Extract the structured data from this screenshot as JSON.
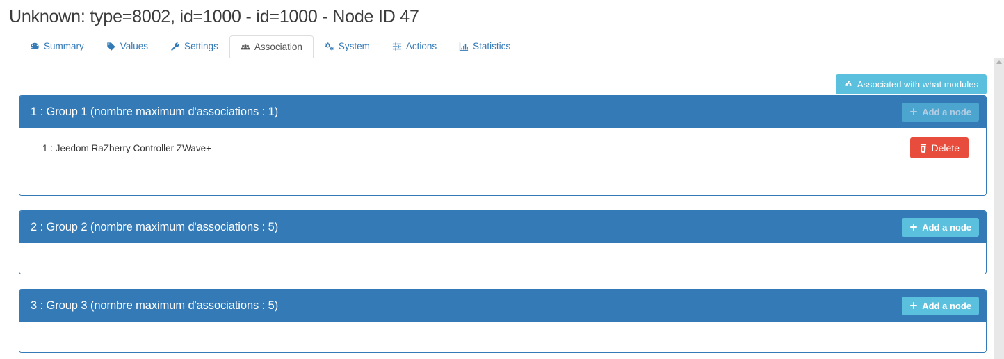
{
  "page": {
    "title": "Unknown: type=8002, id=1000 - id=1000 - Node ID 47"
  },
  "tabs": [
    {
      "label": "Summary",
      "icon": "dashboard-icon",
      "active": false
    },
    {
      "label": "Values",
      "icon": "tag-icon",
      "active": false
    },
    {
      "label": "Settings",
      "icon": "wrench-icon",
      "active": false
    },
    {
      "label": "Association",
      "icon": "users-icon",
      "active": true
    },
    {
      "label": "System",
      "icon": "cogs-icon",
      "active": false
    },
    {
      "label": "Actions",
      "icon": "sliders-icon",
      "active": false
    },
    {
      "label": "Statistics",
      "icon": "bar-chart-icon",
      "active": false
    }
  ],
  "toolbar": {
    "associated_modules_label": "Associated with what modules",
    "associated_modules_icon": "sitemap-icon"
  },
  "groups": [
    {
      "title": "1 : Group 1 (nombre maximum d'associations : 1)",
      "add_node_label": "Add a node",
      "add_node_disabled": true,
      "nodes": [
        {
          "label": "1 : Jeedom RaZberry Controller ZWave+",
          "delete_label": "Delete"
        }
      ]
    },
    {
      "title": "2 : Group 2 (nombre maximum d'associations : 5)",
      "add_node_label": "Add a node",
      "add_node_disabled": false,
      "nodes": []
    },
    {
      "title": "3 : Group 3 (nombre maximum d'associations : 5)",
      "add_node_label": "Add a node",
      "add_node_disabled": false,
      "nodes": []
    }
  ],
  "colors": {
    "primary": "#337ab7",
    "info": "#5bc0de",
    "danger": "#e74c3c",
    "link": "#337ab7",
    "text": "#333333"
  }
}
